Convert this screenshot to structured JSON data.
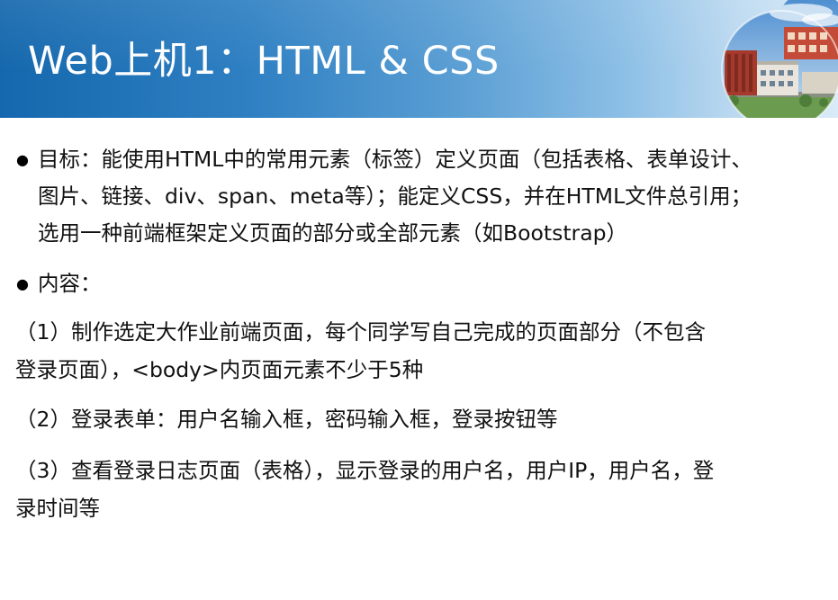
{
  "header": {
    "title": "Web上机1：HTML & CSS"
  },
  "bullets": [
    {
      "lines": [
        "目标：能使用HTML中的常用元素（标签）定义页面（包括表格、表单设计、",
        "图片、链接、div、span、meta等）；能定义CSS，并在HTML文件总引用；",
        "选用一种前端框架定义页面的部分或全部元素（如Bootstrap）"
      ]
    },
    {
      "lines": [
        "内容："
      ]
    }
  ],
  "items": [
    {
      "lines": [
        "（1）制作选定大作业前端页面，每个同学写自己完成的页面部分（不包含",
        "登录页面），<body>内页面元素不少于5种"
      ]
    },
    {
      "lines": [
        "（2）登录表单：用户名输入框，密码输入框，登录按钮等"
      ]
    },
    {
      "lines": [
        "（3）查看登录日志页面（表格），显示登录的用户名，用户IP，用户名，登",
        "录时间等"
      ]
    }
  ],
  "colors": {
    "header_dark": "#1568ad",
    "header_light": "#d9ebf8",
    "title_text": "#ffffff",
    "body_text": "#111111"
  },
  "decor": {
    "photo_icon": "campus-building-photo-icon"
  }
}
